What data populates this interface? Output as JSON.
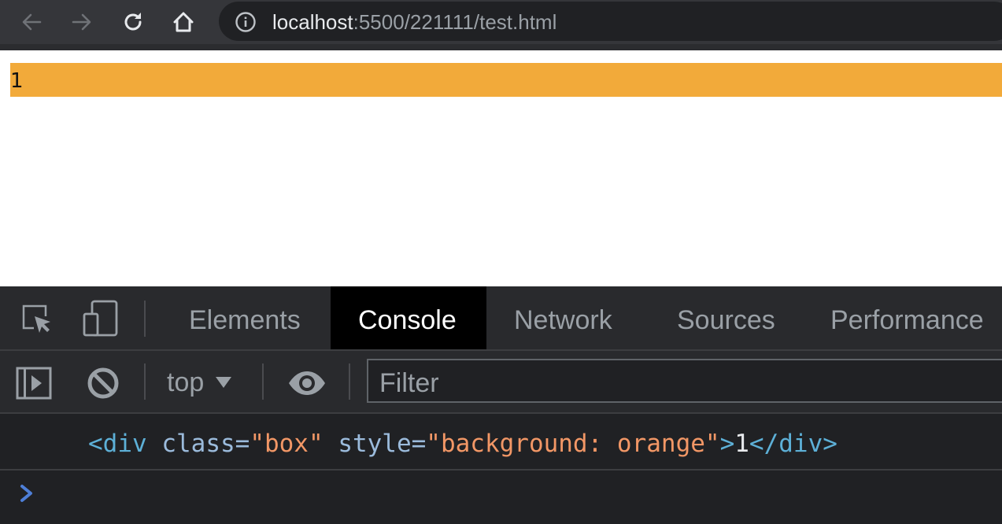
{
  "browser": {
    "url_host": "localhost",
    "url_path": ":5500/221111/test.html",
    "icons": [
      "back-arrow-icon",
      "forward-arrow-icon",
      "reload-icon",
      "home-icon",
      "info-icon"
    ]
  },
  "page": {
    "box_text": "1",
    "box_color": "#f2aa3a"
  },
  "devtools": {
    "tabs": [
      {
        "label": "Elements",
        "active": false
      },
      {
        "label": "Console",
        "active": true
      },
      {
        "label": "Network",
        "active": false
      },
      {
        "label": "Sources",
        "active": false
      },
      {
        "label": "Performance",
        "active": false
      }
    ],
    "console": {
      "context": "top",
      "filter_placeholder": "Filter",
      "log": {
        "open_tag": "<div",
        "attr1_name": "class=",
        "attr1_value": "\"box\"",
        "attr2_name": "style=",
        "attr2_value": "\"background: orange\"",
        "close_open": ">",
        "text": "1",
        "close_tag": "</div>"
      }
    }
  },
  "colors": {
    "accent_orange": "#f2aa3a",
    "console_tag": "#5db0d7",
    "console_value": "#f29766",
    "prompt": "#4e7fd8"
  }
}
